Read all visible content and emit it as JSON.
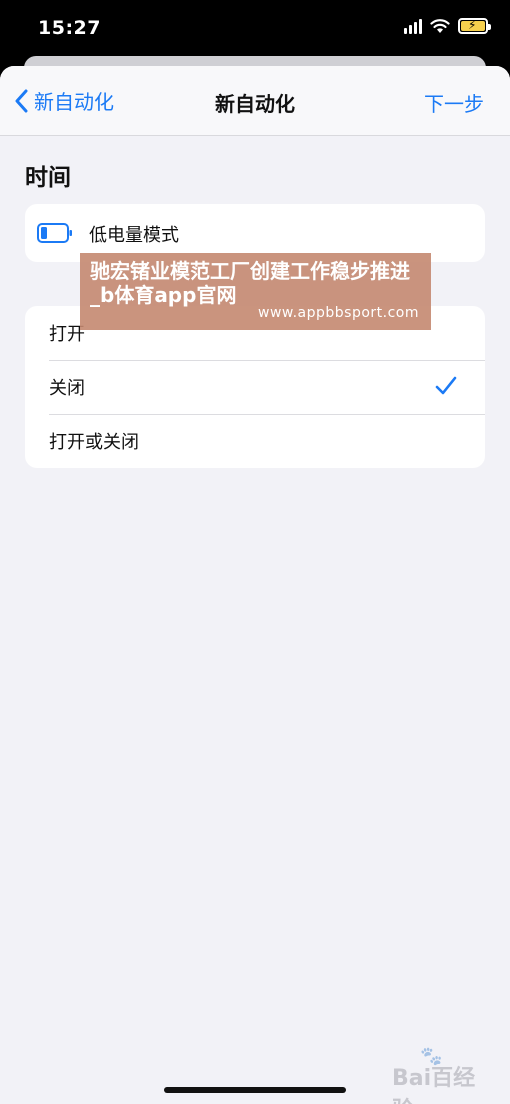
{
  "status": {
    "time": "15:27"
  },
  "nav": {
    "back_label": "新自动化",
    "title": "新自动化",
    "next_label": "下一步"
  },
  "section": {
    "title": "时间"
  },
  "trigger": {
    "label": "低电量模式"
  },
  "options": [
    {
      "label": "打开",
      "selected": false
    },
    {
      "label": "关闭",
      "selected": true
    },
    {
      "label": "打开或关闭",
      "selected": false
    }
  ],
  "watermark": {
    "title": "驰宏锗业模范工厂创建工作稳步推进_b体育app官网",
    "url": "www.appbbsport.com"
  },
  "baidu_mark": {
    "text": "Bai百经验"
  },
  "colors": {
    "accent": "#1b7af5",
    "background": "#f2f2f7",
    "battery_charging": "#f6d04d"
  }
}
